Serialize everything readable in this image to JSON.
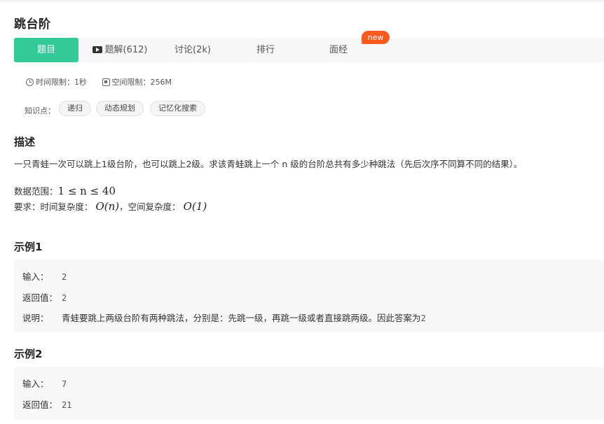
{
  "problem": {
    "title": "跳台阶"
  },
  "tabs": [
    {
      "label": "题目",
      "active": true
    },
    {
      "label": "题解(612)",
      "icon": "video-icon"
    },
    {
      "label": "讨论(2k)"
    },
    {
      "label": "排行"
    },
    {
      "label": "面经",
      "badge": "new"
    }
  ],
  "limits": {
    "time": "时间限制：1秒",
    "space": "空间限制：256M"
  },
  "knowledge": {
    "label": "知识点：",
    "tags": [
      "递归",
      "动态规划",
      "记忆化搜索"
    ]
  },
  "description": {
    "heading": "描述",
    "text": "一只青蛙一次可以跳上1级台阶，也可以跳上2级。求该青蛙跳上一个 n 级的台阶总共有多少种跳法（先后次序不同算不同的结果）。",
    "range_label": "数据范围：",
    "range_math": "1 ≤ n ≤ 40",
    "req_label": "要求：时间复杂度：",
    "time_math": "O(n)",
    "req_mid": "，空间复杂度：",
    "space_math": "O(1)"
  },
  "examples": [
    {
      "heading": "示例1",
      "input_label": "输入：",
      "input": "2",
      "return_label": "返回值：",
      "return": "2",
      "explain_label": "说明：",
      "explain": "青蛙要跳上两级台阶有两种跳法，分别是：先跳一级，再跳一级或者直接跳两级。因此答案为",
      "explain_value": "2"
    },
    {
      "heading": "示例2",
      "input_label": "输入：",
      "input": "7",
      "return_label": "返回值：",
      "return": "21"
    }
  ],
  "colors": {
    "accent": "#32ca99",
    "badge": "#fa5a1e",
    "panel": "#f6f7f9"
  }
}
